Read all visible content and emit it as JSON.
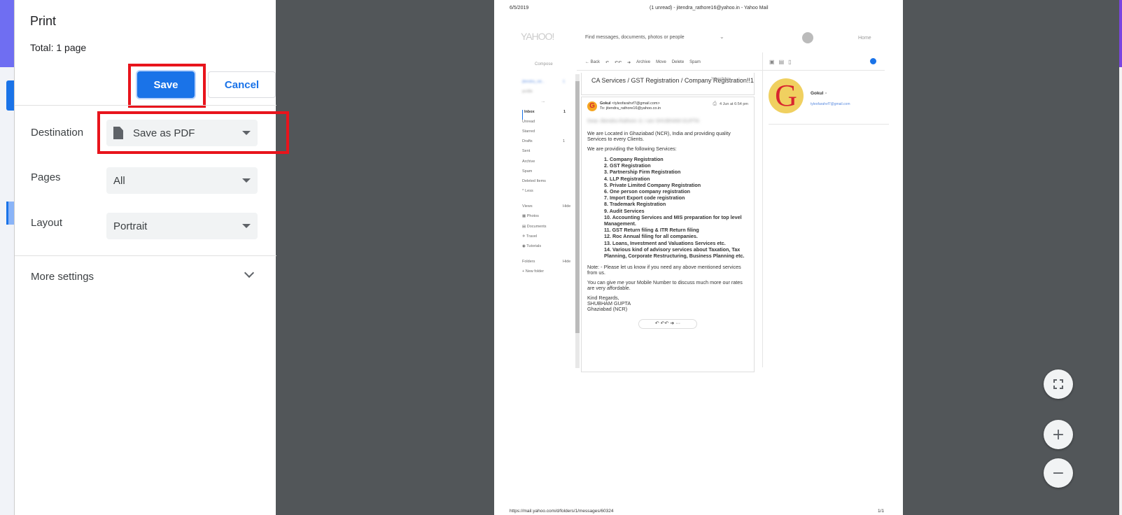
{
  "dialog": {
    "title": "Print",
    "total": "Total: 1 page",
    "save_label": "Save",
    "cancel_label": "Cancel",
    "destination": {
      "label": "Destination",
      "value": "Save as PDF",
      "icon": "document-icon"
    },
    "pages": {
      "label": "Pages",
      "value": "All"
    },
    "layout": {
      "label": "Layout",
      "value": "Portrait"
    },
    "more_settings": "More settings",
    "highlight_color": "#e8141c",
    "accent": "#1a73e8"
  },
  "preview": {
    "header_date": "6/5/2019",
    "header_title": "(1 unread) - jitendra_rathore16@yahoo.in - Yahoo Mail",
    "logo": "YAHOO!",
    "search_placeholder": "Find messages, documents, photos or people",
    "home": "Home",
    "compose": "Compose",
    "toolbar": [
      "← Back",
      "↶",
      "↶↶",
      "➔",
      "Archive",
      "Move",
      "Delete",
      "Spam"
    ],
    "nav": [
      {
        "label": "jitendra_rat...",
        "count": "1",
        "blurred": true
      },
      {
        "label": "profile",
        "count": "",
        "blurred": true
      },
      {
        "label": "...",
        "count": ""
      },
      {
        "label": "Inbox",
        "count": "1",
        "active": true
      },
      {
        "label": "Unread",
        "count": ""
      },
      {
        "label": "Starred",
        "count": ""
      },
      {
        "label": "Drafts",
        "count": "1"
      },
      {
        "label": "Sent",
        "count": ""
      },
      {
        "label": "Archive",
        "count": ""
      },
      {
        "label": "Spam",
        "count": ""
      },
      {
        "label": "Deleted Items",
        "count": ""
      },
      {
        "label": "^ Less",
        "count": ""
      },
      {
        "label": "",
        "count": ""
      },
      {
        "label": "Views",
        "count": "Hide"
      },
      {
        "label": "▦ Photos",
        "count": ""
      },
      {
        "label": "▤ Documents",
        "count": ""
      },
      {
        "label": "✈ Travel",
        "count": ""
      },
      {
        "label": "◉ Tutorials",
        "count": ""
      },
      {
        "label": "",
        "count": ""
      },
      {
        "label": "Folders",
        "count": "Hide"
      },
      {
        "label": "+ New folder",
        "count": ""
      }
    ],
    "subject": "CA Services / GST Registration / Company Registration!!1",
    "folder": "Yahoo/Inbox",
    "sender_name": "Gokul",
    "sender_email": "<tyleofarahvf7@gmail.com>",
    "to": "To: jitendra_rathore16@yahoo.co.in",
    "time": "4 Jun at 6:54 pm",
    "greeting_blurred": "Dear Jitendra Rathore Ji, I am SHUBHAM GUPTA",
    "para1": "We are Located in Ghaziabad (NCR), India and providing quality Services to every Clients.",
    "para2": "We are providing the following Services:",
    "services": [
      "1.  Company Registration",
      "2.  GST Registration",
      "3.  Partnership Firm Registration",
      "4.  LLP Registration",
      "5.  Private Limited Company Registration",
      "6.  One person company registration",
      "7.  Import Export code registration",
      "8.  Trademark Registration",
      "9.  Audit Services",
      "10. Accounting Services and MIS preparation for top level Management.",
      "11. GST Return filing & ITR Return filing",
      "12. Roc Annual filing for all companies.",
      "13. Loans, Investment and Valuations Services etc.",
      "14. Various kind of advisory services about Taxation, Tax Planning, Corporate Restructuring, Business Planning etc."
    ],
    "note": "Note: - Please let us know if you need any above mentioned services from us.",
    "para3": "You can give me your Mobile Number to discuss much more our rates are very affordable.",
    "signoff": [
      "Kind Regards,",
      "SHUBHAM GUPTA",
      "Ghaziabad (NCR)"
    ],
    "actions": "↶  ↶↶  ➔  ···",
    "contact_name": "Gokul",
    "contact_email": "tyleofarahvf7@gmail.com",
    "footer_url": "https://mail.yahoo.com/d/folders/1/messages/60324",
    "page_number": "1/1"
  },
  "zoom_controls": {
    "fit_icon": "fit-to-page-icon",
    "zoom_in": "+",
    "zoom_out": "−"
  }
}
